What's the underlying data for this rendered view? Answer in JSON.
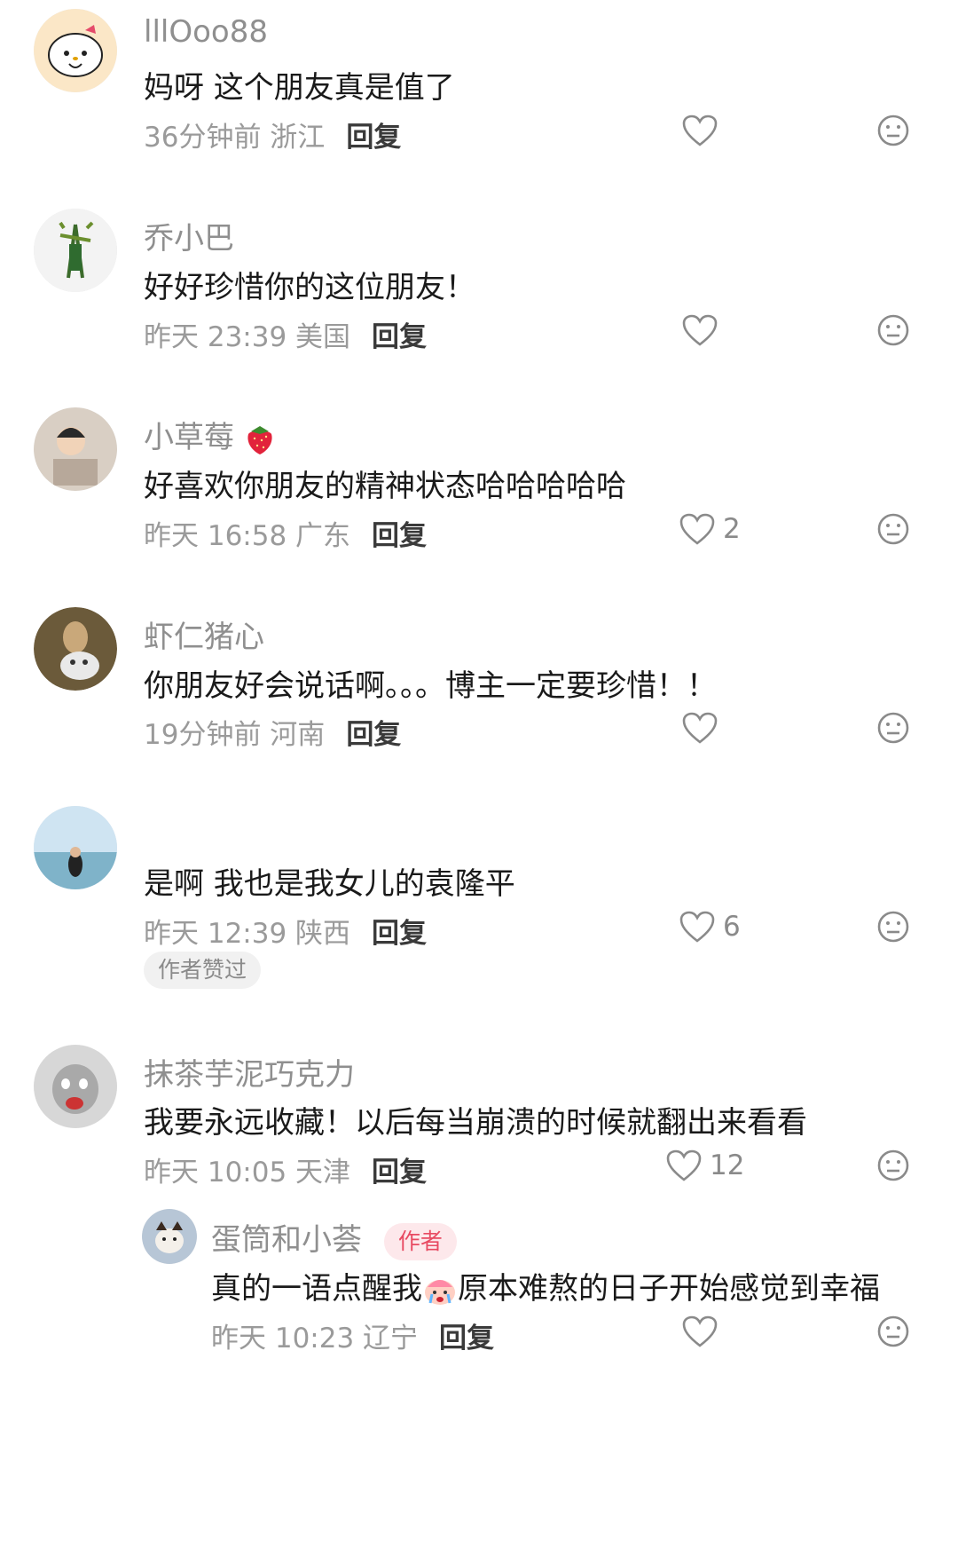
{
  "comments": [
    {
      "username": "lllOoo88",
      "text": "妈呀 这个朋友真是值了",
      "meta": "36分钟前 浙江",
      "reply_label": "回复",
      "likes": ""
    },
    {
      "username": "乔小巴",
      "text": "好好珍惜你的这位朋友！",
      "meta": "昨天 23:39 美国",
      "reply_label": "回复",
      "likes": ""
    },
    {
      "username": "小草莓",
      "text": "好喜欢你朋友的精神状态哈哈哈哈哈",
      "meta": "昨天 16:58 广东",
      "reply_label": "回复",
      "likes": "2"
    },
    {
      "username": "虾仁猪心",
      "text": "你朋友好会说话啊。。。博主一定要珍惜！！",
      "meta": "19分钟前 河南",
      "reply_label": "回复",
      "likes": ""
    },
    {
      "username": "",
      "text": "是啊 我也是我女儿的袁隆平",
      "meta": "昨天 12:39 陕西",
      "reply_label": "回复",
      "likes": "6",
      "badge": "作者赞过"
    },
    {
      "username": "抹茶芋泥巧克力",
      "text": "我要永远收藏！以后每当崩溃的时候就翻出来看看",
      "meta": "昨天 10:05 天津",
      "reply_label": "回复",
      "likes": "12"
    }
  ],
  "reply": {
    "username": "蛋筒和小荟",
    "author_tag": "作者",
    "text_part1": "真的一语点醒我",
    "text_part2": "原本难熬的日子开始感觉到幸福",
    "meta": "昨天 10:23 辽宁",
    "reply_label": "回复",
    "likes": ""
  },
  "icons": {
    "like": "heart-outline-icon",
    "dislike": "neutral-face-icon",
    "strawberry": "strawberry-emoji",
    "crying": "crying-face-emoji"
  },
  "colors": {
    "username": "#8f8f8f",
    "text": "#1a1a1a",
    "meta": "#9a9a9a",
    "author_tag_bg": "#fde8eb",
    "author_tag_fg": "#e84a62"
  }
}
